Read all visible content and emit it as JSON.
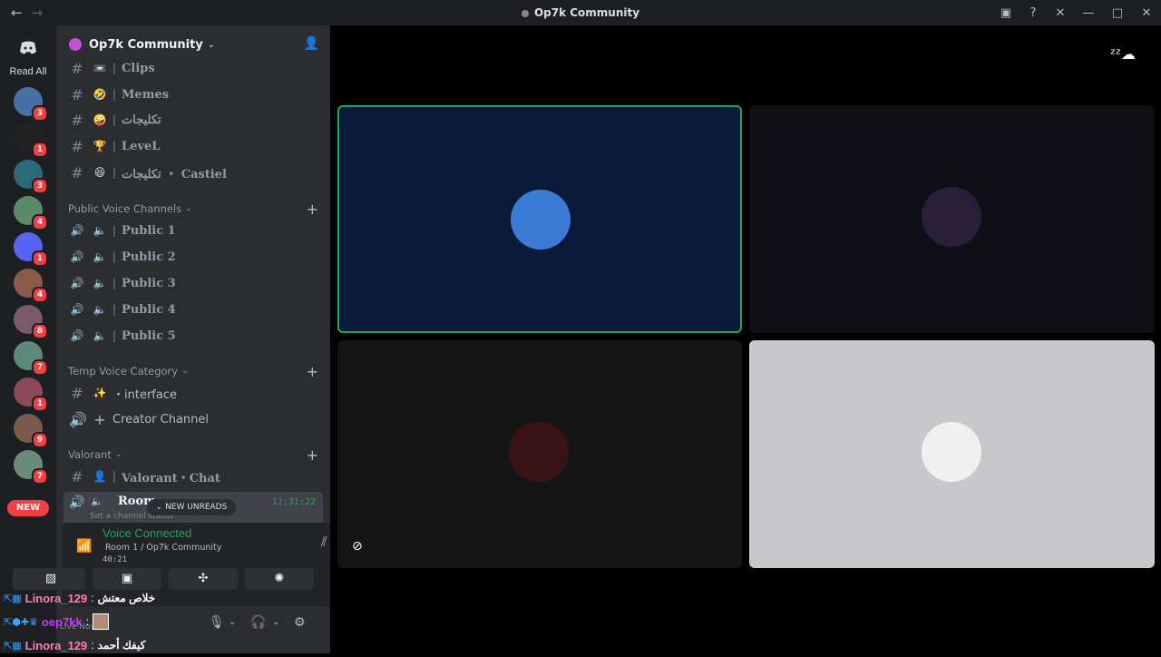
{
  "window": {
    "title": "Op7k Community"
  },
  "servers": {
    "read_all": "Read All",
    "new_label": "NEW",
    "items": [
      {
        "badge": "3",
        "color": "#4a6fa5"
      },
      {
        "badge": "1",
        "color": "#222222"
      },
      {
        "badge": "3",
        "color": "#2c6a7a"
      },
      {
        "badge": "4",
        "color": "#5a8a6a"
      },
      {
        "badge": "1",
        "color": "#5865f2"
      },
      {
        "badge": "4",
        "color": "#8a5a4a"
      },
      {
        "badge": "8",
        "color": "#7a5a6a"
      },
      {
        "badge": "7",
        "color": "#5a8a7a"
      },
      {
        "badge": "1",
        "color": "#8a4a5a"
      },
      {
        "badge": "9",
        "color": "#7a5a4a"
      },
      {
        "badge": "7",
        "color": "#6a8a7a"
      }
    ]
  },
  "guild": {
    "name": "Op7k Community"
  },
  "channels": {
    "top": [
      {
        "emoji": "📼",
        "name": "Clips"
      },
      {
        "emoji": "🤣",
        "name": "Memes"
      },
      {
        "emoji": "🤪",
        "name": "تكليجات"
      },
      {
        "emoji": "🏆",
        "name": "LeveL"
      },
      {
        "emoji": "😆",
        "name": "تكليجات ・ Castiel"
      }
    ],
    "public_voice": {
      "label": "Public Voice Channels",
      "items": [
        "Public 1",
        "Public 2",
        "Public 3",
        "Public 4",
        "Public 5"
      ]
    },
    "temp_voice": {
      "label": "Temp Voice Category",
      "items": [
        {
          "emoji": "✨",
          "name": "・interface"
        },
        {
          "emoji": "+",
          "name": "Creator Channel"
        }
      ]
    },
    "valorant": {
      "label": "Valorant",
      "items": [
        {
          "emoji": "👤",
          "name": "Valorant・Chat"
        }
      ],
      "room": {
        "name": "Room",
        "status": "Set a channel status",
        "time": "12:31:22"
      }
    },
    "new_unreads": "NEW UNREADS"
  },
  "voice": {
    "title": "Voice Connected",
    "sub": "Room 1 / Op7k Community",
    "time": "40:21"
  },
  "user": {
    "name": "oep7kk",
    "status": "Live Now!"
  },
  "chat": [
    {
      "user": "Linora_129",
      "user_color": "#ff7eb6",
      "message": "خلاص معتش"
    },
    {
      "user": "oep7kk",
      "user_color": "#c23cff",
      "message": ""
    },
    {
      "user": "Linora_129",
      "user_color": "#ff7eb6",
      "message": "كيفك أحمد"
    }
  ],
  "tiles": [
    {
      "name": "tile-1",
      "bg": "#0a1a3a",
      "avatar_color": "#3b7bd6",
      "speaking": true
    },
    {
      "name": "tile-2",
      "bg": "#100f16",
      "avatar_color": "#2a1f3a",
      "speaking": false
    },
    {
      "name": "tile-3",
      "bg": "#151515",
      "avatar_color": "#3a1414",
      "speaking": false
    },
    {
      "name": "tile-4",
      "bg": "#c8c8cc",
      "avatar_color": "#f0f0f0",
      "speaking": false
    }
  ]
}
